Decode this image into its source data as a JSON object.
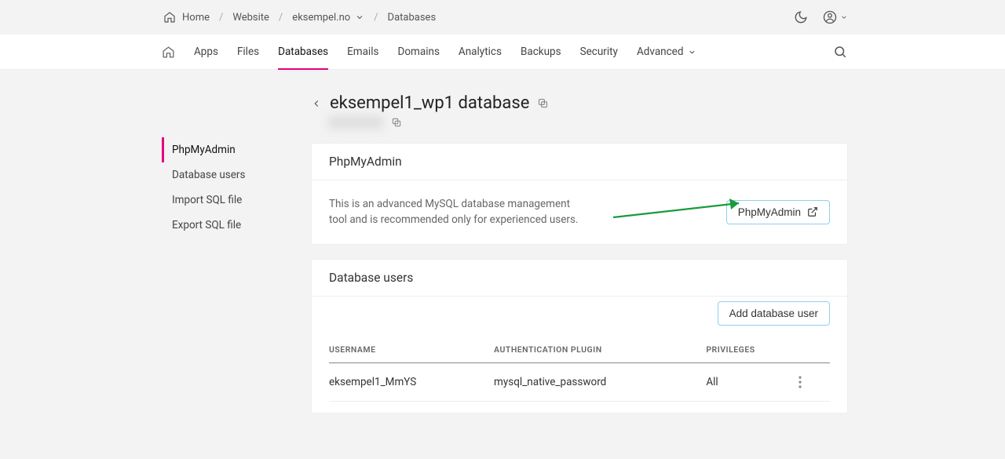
{
  "breadcrumb": {
    "home": "Home",
    "website": "Website",
    "domain": "eksempel.no",
    "databases": "Databases"
  },
  "nav": {
    "apps": "Apps",
    "files": "Files",
    "databases": "Databases",
    "emails": "Emails",
    "domains": "Domains",
    "analytics": "Analytics",
    "backups": "Backups",
    "security": "Security",
    "advanced": "Advanced"
  },
  "sidebar": {
    "phpmyadmin": "PhpMyAdmin",
    "dbusers": "Database users",
    "importsql": "Import SQL file",
    "exportsql": "Export SQL file"
  },
  "header": {
    "title": "eksempel1_wp1 database"
  },
  "phpmyadmin_card": {
    "title": "PhpMyAdmin",
    "desc": "This is an advanced MySQL database management tool and is recommended only for experienced users.",
    "button": "PhpMyAdmin"
  },
  "users_card": {
    "title": "Database users",
    "add_button": "Add database user",
    "columns": {
      "username": "USERNAME",
      "auth": "AUTHENTICATION PLUGIN",
      "priv": "PRIVILEGES"
    },
    "rows": [
      {
        "username": "eksempel1_MmYS",
        "auth": "mysql_native_password",
        "priv": "All"
      }
    ]
  }
}
